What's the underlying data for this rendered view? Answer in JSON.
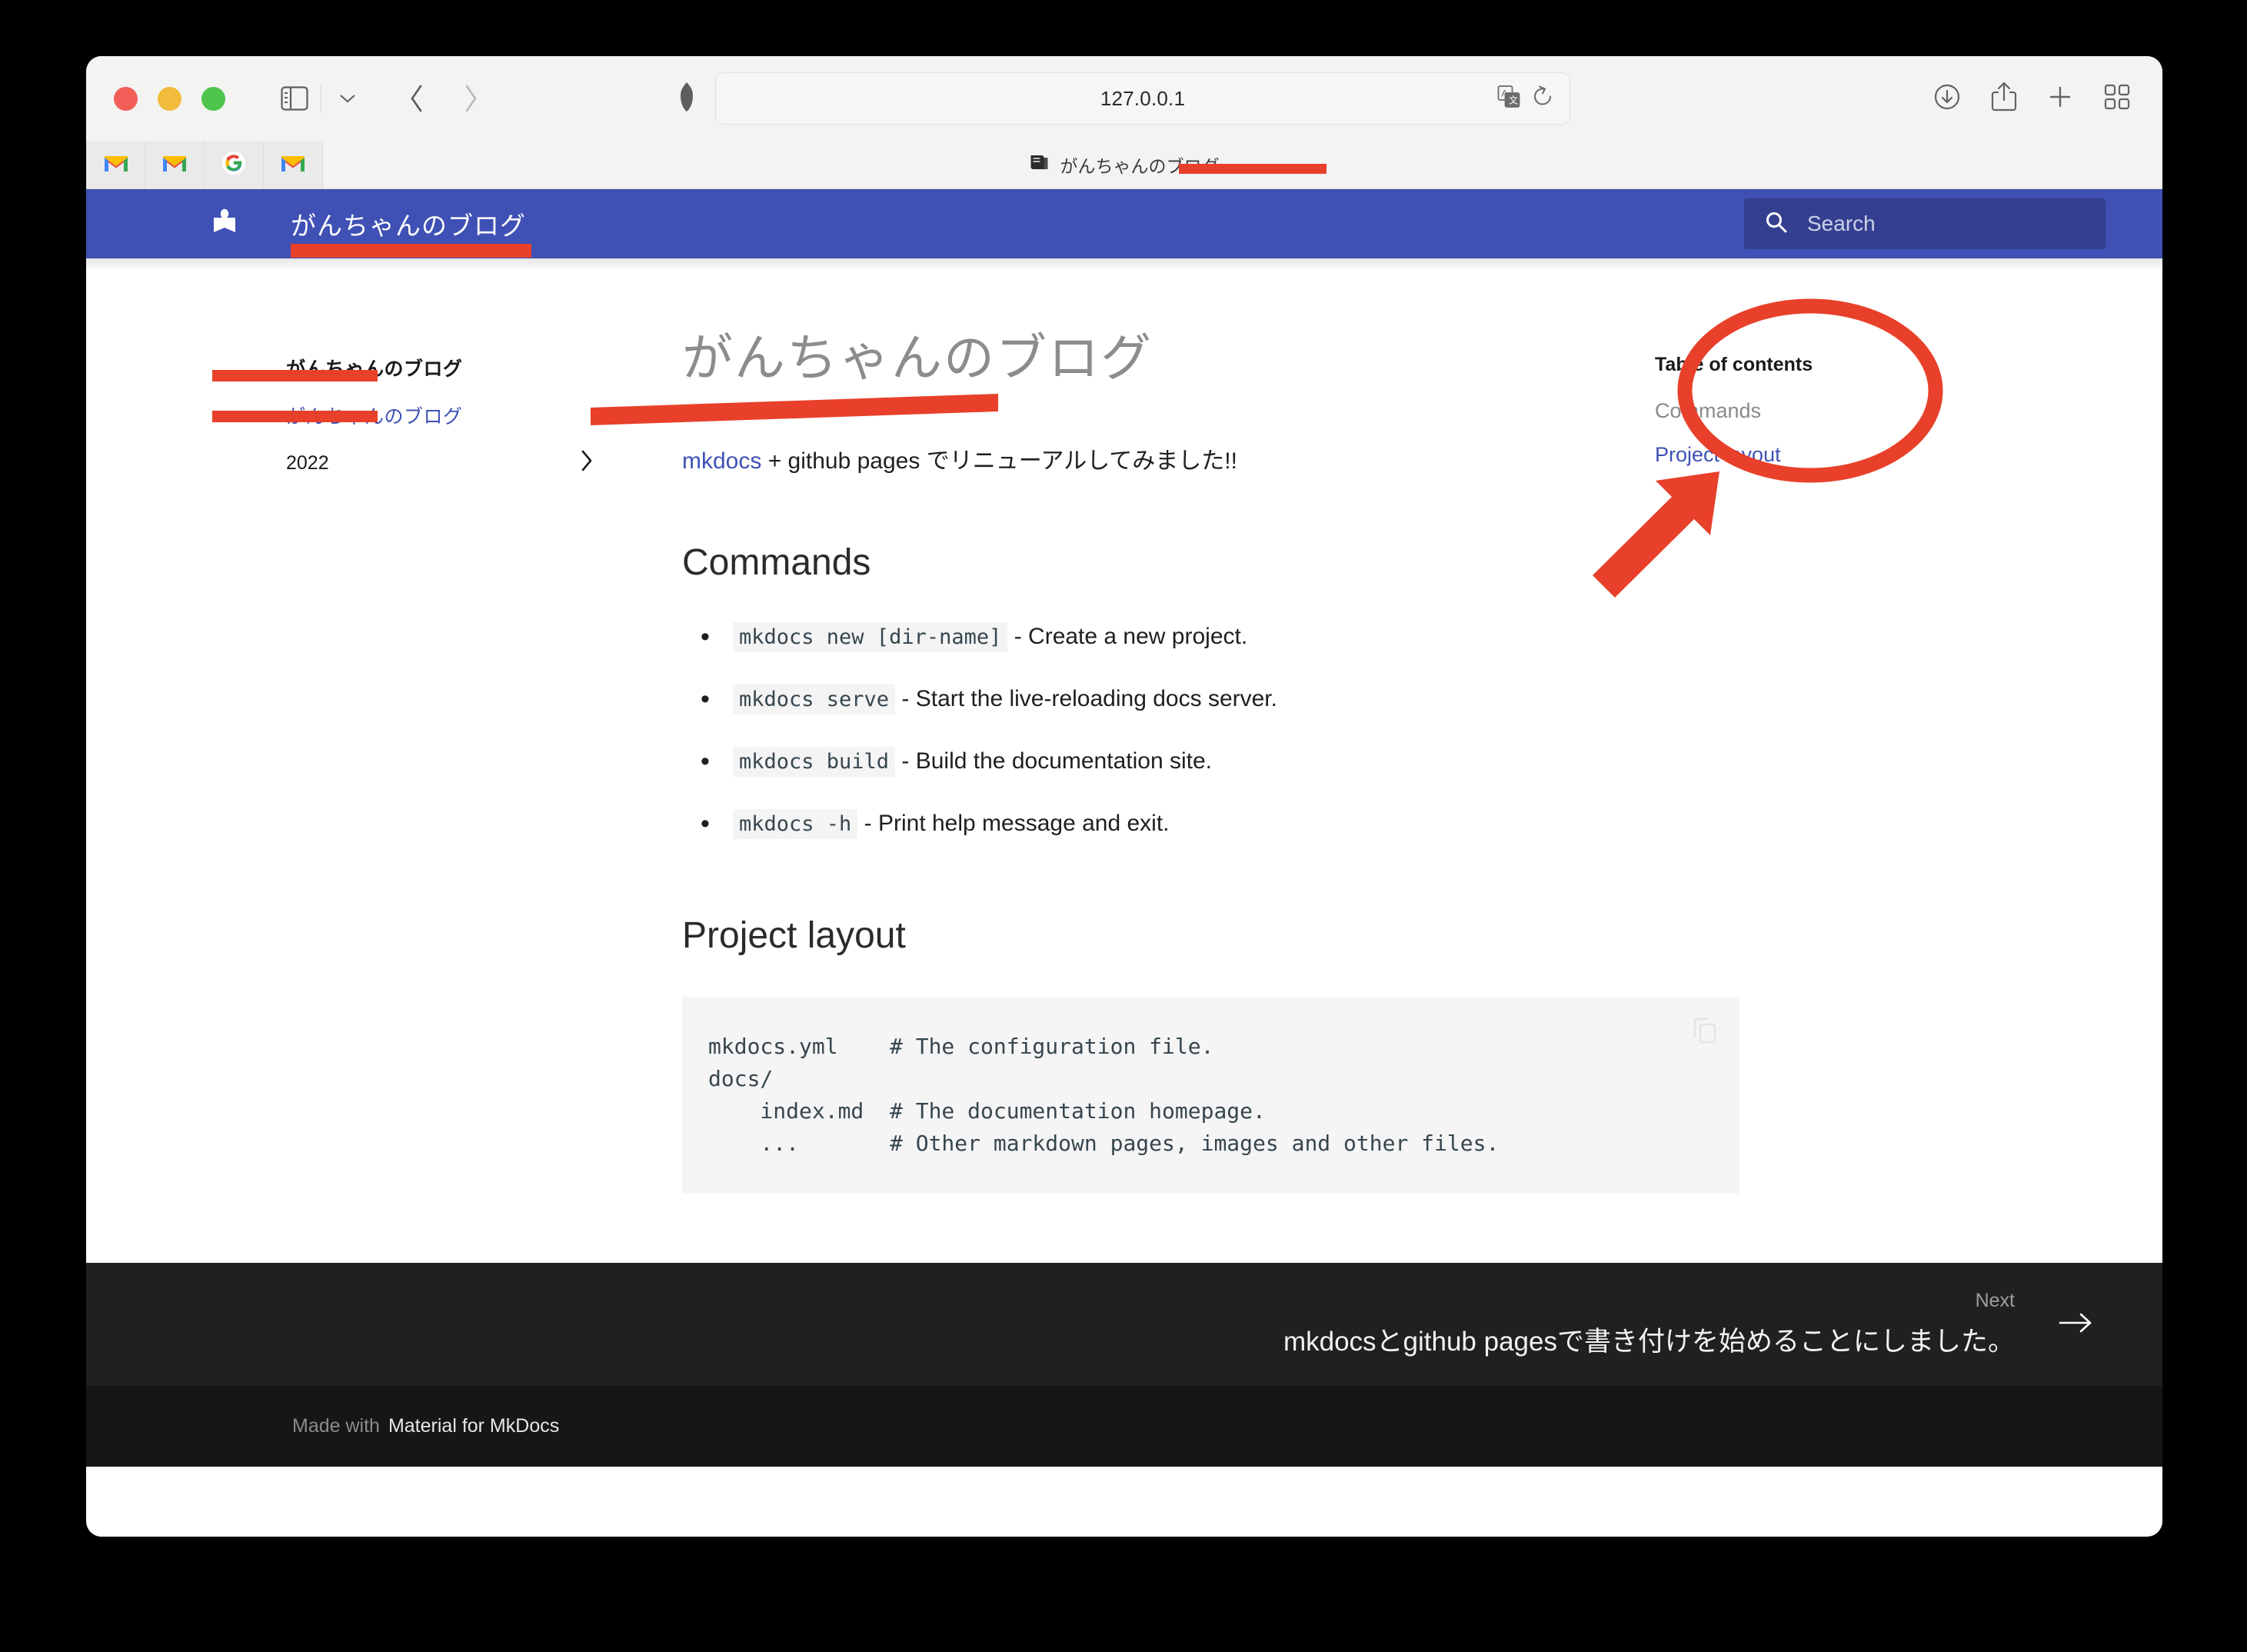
{
  "browser": {
    "url": "127.0.0.1",
    "traffic_lights": [
      "close-button",
      "minimize-button",
      "zoom-button"
    ],
    "toolbar_icons": {
      "sidebar": "sidebar-icon",
      "sidebar_chevron": "chevron-down-icon",
      "back": "back-chevron-icon",
      "forward": "forward-chevron-icon",
      "shield": "privacy-shield-icon",
      "translate": "translate-icon",
      "reload": "reload-icon",
      "downloads": "download-icon",
      "share": "share-icon",
      "new_tab": "plus-icon",
      "tab_overview": "tab-grid-icon"
    },
    "favorite_tabs": [
      "gmail-icon",
      "gmail-icon",
      "google-icon",
      "gmail-icon"
    ],
    "active_tab": {
      "icon": "book-icon",
      "title": "がんちゃんのブログ"
    }
  },
  "site_header": {
    "logo": "mkdocs-material-book-logo",
    "title": "がんちゃんのブログ",
    "search_placeholder": "Search",
    "search_value": "",
    "accent_color": "#3f51b5",
    "search_bg": "#34408f"
  },
  "sidebar": {
    "heading": "がんちゃんのブログ",
    "items": [
      {
        "label": "がんちゃんのブログ",
        "active": true,
        "expandable": false
      },
      {
        "label": "2022",
        "active": false,
        "expandable": true,
        "chevron": "chevron-right-icon"
      }
    ]
  },
  "content": {
    "title": "がんちゃんのブログ",
    "intro": {
      "link_text": "mkdocs",
      "rest": " + github pages でリニューアルしてみました!!"
    },
    "sections": [
      {
        "heading": "Commands",
        "commands": [
          {
            "code": "mkdocs new [dir-name]",
            "desc": " - Create a new project."
          },
          {
            "code": "mkdocs serve",
            "desc": " - Start the live-reloading docs server."
          },
          {
            "code": "mkdocs build",
            "desc": " - Build the documentation site."
          },
          {
            "code": "mkdocs -h",
            "desc": " - Print help message and exit."
          }
        ]
      },
      {
        "heading": "Project layout",
        "code": "mkdocs.yml    # The configuration file.\ndocs/\n    index.md  # The documentation homepage.\n    ...       # Other markdown pages, images and other files.",
        "copy_icon": "copy-icon"
      }
    ]
  },
  "toc": {
    "title": "Table of contents",
    "items": [
      {
        "label": "Commands",
        "active": false
      },
      {
        "label": "Project layout",
        "active": true
      }
    ]
  },
  "footer_nav": {
    "next_label": "Next",
    "next_title": "mkdocsとgithub pagesで書き付けを始めることにしました。",
    "arrow": "arrow-right-icon"
  },
  "footer_meta": {
    "made_with": "Made with",
    "brand": "Material for MkDocs"
  },
  "annotations": {
    "color": "#e8402a",
    "marks": [
      "underline-tab-title",
      "underline-header-title",
      "underline-sidebar-heading",
      "underline-sidebar-link",
      "underline-page-title",
      "ellipse-around-toc",
      "arrow-pointing-to-toc"
    ]
  }
}
